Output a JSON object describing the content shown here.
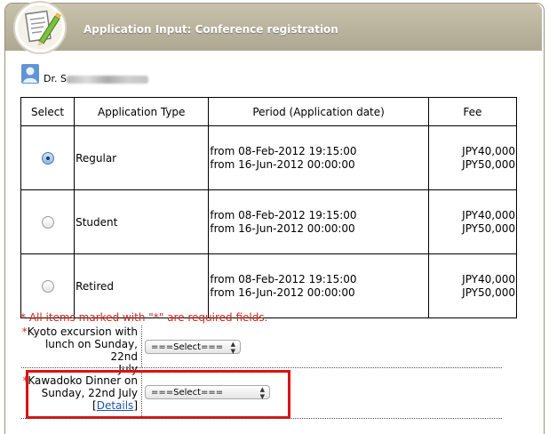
{
  "header": {
    "title": "Application Input: Conference registration"
  },
  "user": {
    "prefix": "Dr. S"
  },
  "table": {
    "columns": [
      "Select",
      "Application Type",
      "Period (Application date)",
      "Fee"
    ],
    "rows": [
      {
        "type": "Regular",
        "period_1": "from 08-Feb-2012 19:15:00",
        "period_2": "from 16-Jun-2012 00:00:00",
        "fee_1": "JPY40,000",
        "fee_2": "JPY50,000",
        "selected": true
      },
      {
        "type": "Student",
        "period_1": "from 08-Feb-2012 19:15:00",
        "period_2": "from 16-Jun-2012 00:00:00",
        "fee_1": "JPY40,000",
        "fee_2": "JPY50,000",
        "selected": false
      },
      {
        "type": "Retired",
        "period_1": "from 08-Feb-2012 19:15:00",
        "period_2": "from 16-Jun-2012 00:00:00",
        "fee_1": "JPY40,000",
        "fee_2": "JPY50,000",
        "selected": false
      }
    ]
  },
  "form": {
    "required_note": "* All items marked with \"*\" are required fields.",
    "required_mark": "*",
    "kyoto": {
      "label_1": "Kyoto excursion with",
      "label_2": "lunch on Sunday, 22nd",
      "label_3": "July",
      "select_value": "===Select==="
    },
    "dinner": {
      "label_1": "Kawadoko Dinner on",
      "label_2": "Sunday, 22nd July",
      "details_open": "[",
      "details_link": "Details",
      "details_close": "]",
      "select_value": "===Select==="
    }
  },
  "colors": {
    "header_bg": "#b8b19c",
    "required_red": "#d5261b",
    "highlight_red": "#e01010",
    "link_blue": "#1b55a3"
  },
  "icons": [
    "app-logo-icon",
    "user-icon",
    "select-arrows-icon"
  ]
}
